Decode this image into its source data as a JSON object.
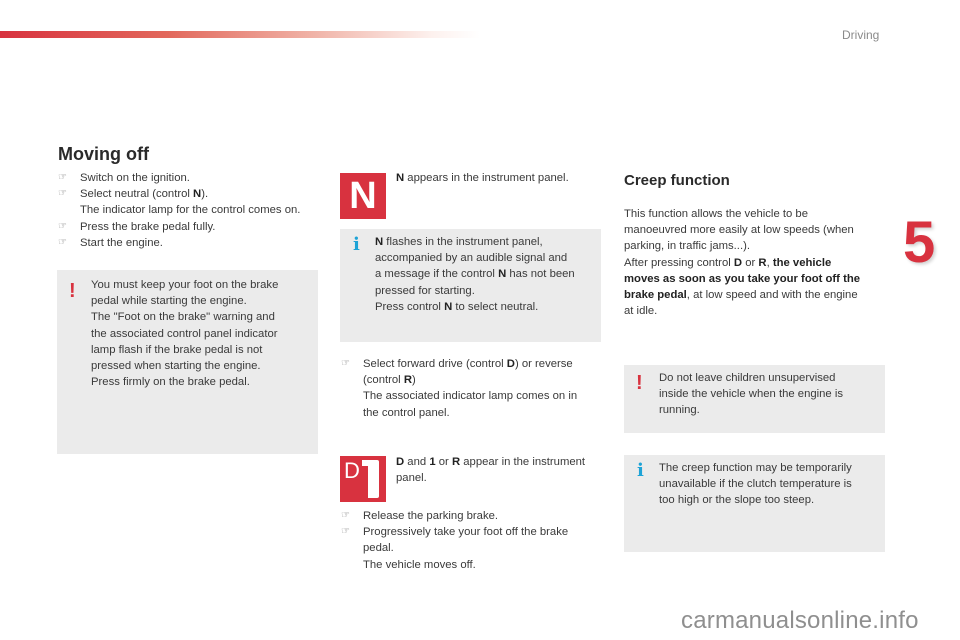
{
  "header": {
    "section": "Driving",
    "chapter_number": "5"
  },
  "left": {
    "title": "Moving off",
    "steps": [
      {
        "text": "Switch on the ignition."
      },
      {
        "pre": "Select neutral (control ",
        "bold": "N",
        "post": ").",
        "sub": "The indicator lamp for the control comes on."
      },
      {
        "text": "Press the brake pedal fully."
      },
      {
        "text": "Start the engine."
      }
    ],
    "warning": {
      "icon": "warning-icon",
      "lines": [
        "You must keep your foot on the brake",
        "pedal while starting the engine.",
        "The \"Foot on the brake\" warning and",
        "the associated control panel indicator",
        "lamp flash if the brake pedal is not",
        "pressed when starting the engine.",
        "Press firmly on the brake pedal."
      ]
    }
  },
  "middle": {
    "n_tile": {
      "glyph": "N"
    },
    "n_caption": {
      "bold": "N",
      "rest": " appears in the instrument panel."
    },
    "info": {
      "icon": "info-icon",
      "l1_bold": "N",
      "l1_rest": " flashes in the instrument panel,",
      "l2": "accompanied by an audible signal and",
      "l3_pre": "a message if the control ",
      "l3_bold": "N",
      "l3_post": " has not been",
      "l4": "pressed for starting.",
      "l5_pre": "Press control ",
      "l5_bold": "N",
      "l5_post": " to select neutral."
    },
    "step_drive": {
      "pre": "Select forward drive (control ",
      "b1": "D",
      "mid": ") or reverse",
      "pre2": "(control ",
      "b2": "R",
      "post2": ")",
      "sub1": "The associated indicator lamp comes on in",
      "sub2": "the control panel."
    },
    "d1_tile": {
      "letter": "D",
      "digit": "1"
    },
    "d1_caption": {
      "b1": "D",
      "t1": " and ",
      "b2": "1",
      "t2": " or ",
      "b3": "R",
      "t3": " appear in the instrument",
      "l2": "panel."
    },
    "steps_end": [
      {
        "text": "Release the parking brake."
      },
      {
        "text": "Progressively take your foot off the brake",
        "text2": "pedal.",
        "sub": "The vehicle moves off."
      }
    ]
  },
  "right": {
    "title": "Creep function",
    "para": {
      "l1": "This function allows the vehicle to be",
      "l2": "manoeuvred more easily at low speeds (when",
      "l3": "parking, in traffic jams...).",
      "l4_pre": "After pressing control ",
      "l4_b1": "D",
      "l4_or": " or ",
      "l4_b2": "R",
      "l4_comma": ", ",
      "l4_b3": "the vehicle",
      "l5_b": "moves as soon as you take your foot off the",
      "l6_b": "brake pedal",
      "l6_rest": ", at low speed and with the engine",
      "l7": "at idle."
    },
    "warning": {
      "lines": [
        "Do not leave children unsupervised",
        "inside the vehicle when the engine is",
        "running."
      ]
    },
    "info": {
      "lines": [
        "The creep function may be temporarily",
        "unavailable if the clutch temperature is",
        "too high or the slope too steep."
      ]
    }
  },
  "footer": {
    "watermark": "carmanualsonline.info"
  }
}
